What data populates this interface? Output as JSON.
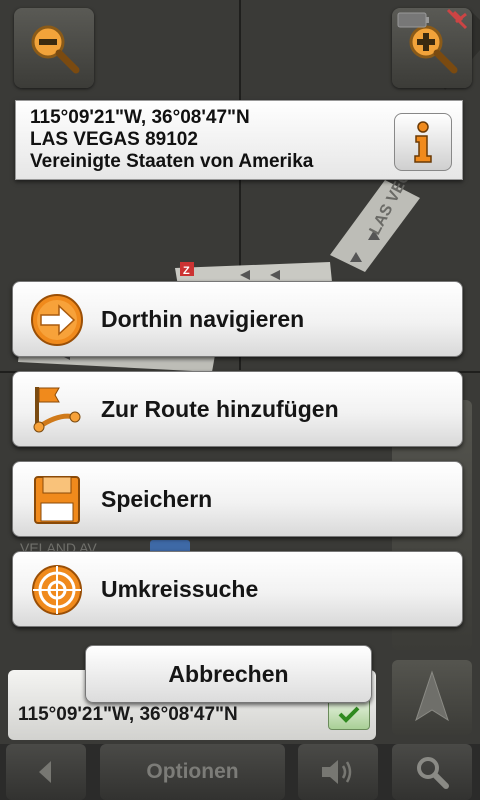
{
  "location": {
    "coordinates": "115°09'21\"W, 36°08'47\"N",
    "city_zip": "LAS VEGAS 89102",
    "country": "Vereinigte Staaten von Amerika"
  },
  "menu": {
    "items": [
      {
        "label": "Dorthin navigieren",
        "icon": "arrow-right-icon"
      },
      {
        "label": "Zur Route hinzufügen",
        "icon": "add-to-route-icon"
      },
      {
        "label": "Speichern",
        "icon": "save-icon"
      },
      {
        "label": "Umkreissuche",
        "icon": "nearby-search-icon"
      }
    ],
    "cancel_label": "Abbrechen"
  },
  "coord_bar": {
    "text": "115°09'21\"W, 36°08'47\"N"
  },
  "bottom_bar": {
    "options_label": "Optionen"
  },
  "map": {
    "street_label": "LAS VEGAS",
    "street_label_2": "VELAND AV"
  },
  "colors": {
    "accent": "#f08a1c",
    "map_bg": "#3a3a37",
    "road": "#b9b9b3"
  }
}
